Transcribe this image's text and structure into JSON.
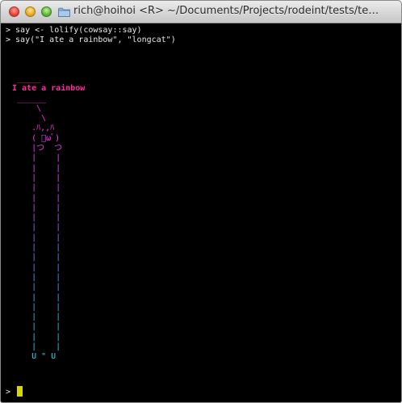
{
  "window": {
    "title": "rich@hoihoi <R> ~/Documents/Projects/rodeint/tests/te…"
  },
  "terminal": {
    "history": [
      "> say <- lolify(cowsay::say)",
      "> say(\"I ate a rainbow\", \"longcat\")"
    ],
    "ascii_art": [
      {
        "text": " _____",
        "color": "#ff2266"
      },
      {
        "text": "I ate a rainbow",
        "color": "#ff2aa0",
        "bold": true
      },
      {
        "text": " ______",
        "color": "#ff22c8"
      },
      {
        "text": "     \\",
        "color": "#ff28e0"
      },
      {
        "text": "      \\",
        "color": "#ff2ef0"
      },
      {
        "text": "    .ﾊ,,ﾊ",
        "color": "#ff36f5"
      },
      {
        "text": "    ( ﾟωﾟ)",
        "color": "#f83cf8"
      },
      {
        "text": "    |つ  つ",
        "color": "#f040f8"
      },
      {
        "text": "    |    |",
        "color": "#e644f8"
      },
      {
        "text": "    |    |",
        "color": "#dc48f8"
      },
      {
        "text": "    |    |",
        "color": "#d24cf8"
      },
      {
        "text": "    |    |",
        "color": "#c650f8"
      },
      {
        "text": "    |    |",
        "color": "#ba56f8"
      },
      {
        "text": "    |    |",
        "color": "#ae5cf8"
      },
      {
        "text": "    |    |",
        "color": "#a262f8"
      },
      {
        "text": "    |    |",
        "color": "#9668f8"
      },
      {
        "text": "    |    |",
        "color": "#8a70f8"
      },
      {
        "text": "    |    |",
        "color": "#7e78f8"
      },
      {
        "text": "    |    |",
        "color": "#7280f8"
      },
      {
        "text": "    |    |",
        "color": "#6688f8"
      },
      {
        "text": "    |    |",
        "color": "#5a92f8"
      },
      {
        "text": "    |    |",
        "color": "#4e9cf8"
      },
      {
        "text": "    |    |",
        "color": "#44a6f6"
      },
      {
        "text": "    |    |",
        "color": "#3ab0f4"
      },
      {
        "text": "    |    |",
        "color": "#30bcf0"
      },
      {
        "text": "    |    |",
        "color": "#28c6ee"
      },
      {
        "text": "    |    |",
        "color": "#22ceec"
      },
      {
        "text": "    |    |",
        "color": "#1ed6ec"
      },
      {
        "text": "    U \" U",
        "color": "#1cdcec"
      }
    ],
    "prompt": "> ",
    "cursor_color": "#d6d600"
  },
  "colors": {
    "background": "#000000",
    "text": "#e8e8e8"
  }
}
